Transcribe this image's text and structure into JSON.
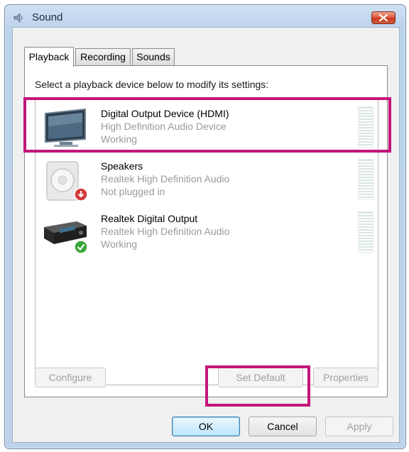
{
  "window": {
    "title": "Sound"
  },
  "tabs": [
    {
      "label": "Playback",
      "active": true
    },
    {
      "label": "Recording",
      "active": false
    },
    {
      "label": "Sounds",
      "active": false
    }
  ],
  "playback": {
    "instruction": "Select a playback device below to modify its settings:",
    "devices": [
      {
        "name": "Digital Output Device (HDMI)",
        "description": "High Definition Audio Device",
        "status": "Working",
        "icon": "hdmi-monitor-icon",
        "highlighted": true
      },
      {
        "name": "Speakers",
        "description": "Realtek High Definition Audio",
        "status": "Not plugged in",
        "icon": "speaker-icon",
        "status_icon": "unplugged-icon"
      },
      {
        "name": "Realtek Digital Output",
        "description": "Realtek High Definition Audio",
        "status": "Working",
        "icon": "digital-receiver-icon",
        "status_icon": "default-check-icon"
      }
    ],
    "buttons": {
      "configure": "Configure",
      "set_default": "Set Default",
      "properties": "Properties"
    }
  },
  "dialog_buttons": {
    "ok": "OK",
    "cancel": "Cancel",
    "apply": "Apply"
  },
  "colors": {
    "highlight": "#c4157a",
    "close_button": "#d04a2c"
  }
}
